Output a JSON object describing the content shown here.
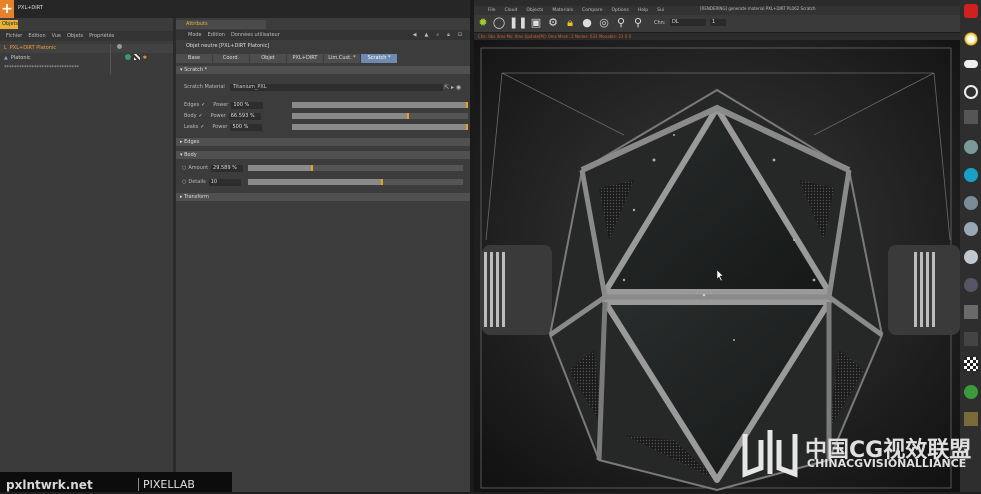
{
  "app": {
    "title": "PXL+DIRT",
    "colors": {
      "accent": "#e8822a",
      "tab_active": "#6e8ab0",
      "slider_knob": "#e8a020",
      "status": "#d06030"
    }
  },
  "left_panel": {
    "tab": "Objets",
    "menu": [
      "Fichier",
      "Edition",
      "Vue",
      "Objets",
      "Propriétés"
    ],
    "objects": [
      {
        "name": "PXL+DIRT Platonic",
        "selected": true
      },
      {
        "name": "Platonic",
        "selected": false
      },
      {
        "name": "******************************",
        "selected": false
      }
    ]
  },
  "attributes": {
    "tab": "Attributs",
    "menu": [
      "Mode",
      "Edition",
      "Données utilisateur"
    ],
    "object_title": "Objet neutre [PXL+DIRT Platonic]",
    "tabs": [
      "Base",
      "Coord.",
      "Objet",
      "PXL+DIRT",
      "Lim.Cust. *",
      "Scratch *"
    ],
    "active_tab": "Scratch *",
    "section_scratch": "Scratch *",
    "scratch_material_label": "Scratch Material",
    "scratch_material_value": "Titanium_PXL",
    "params": [
      {
        "label": "Edges",
        "power_label": "Power",
        "value": "100 %",
        "fraction": 1.0
      },
      {
        "label": "Body",
        "power_label": "Power",
        "value": "66.593 %",
        "fraction": 0.666
      },
      {
        "label": "Leaks",
        "power_label": "Power",
        "value": "500 %",
        "fraction": 1.0
      }
    ],
    "section_edges": "Edges",
    "section_body": "Body",
    "body_params": [
      {
        "label": "Amount",
        "value": "29.589 %",
        "fraction": 0.3
      },
      {
        "label": "Details",
        "value": "10",
        "fraction": 0.63
      }
    ],
    "section_transform": "Transform"
  },
  "viewport": {
    "render_title": "[RENDERING] generate material PXL+DIRT PL062 Scratch",
    "menu": [
      "File",
      "Cloud",
      "Objects",
      "Materials",
      "Compare",
      "Options",
      "Help",
      "Sui"
    ],
    "channel_label": "Chn:",
    "channel_value": "DL",
    "zoom_value": "1",
    "status_text": "Chk: 0bs 0ms  Ms: 0ms  Update[M]: 0ms  Mesh: 2  Nodes: 631  Movable: 23  0 0"
  },
  "watermark": {
    "site": "pxlntwrk.net",
    "brand": "PIXELLAB",
    "cn": "中国CG视效联盟",
    "en": "CHINACGVISIONALLIANCE"
  }
}
